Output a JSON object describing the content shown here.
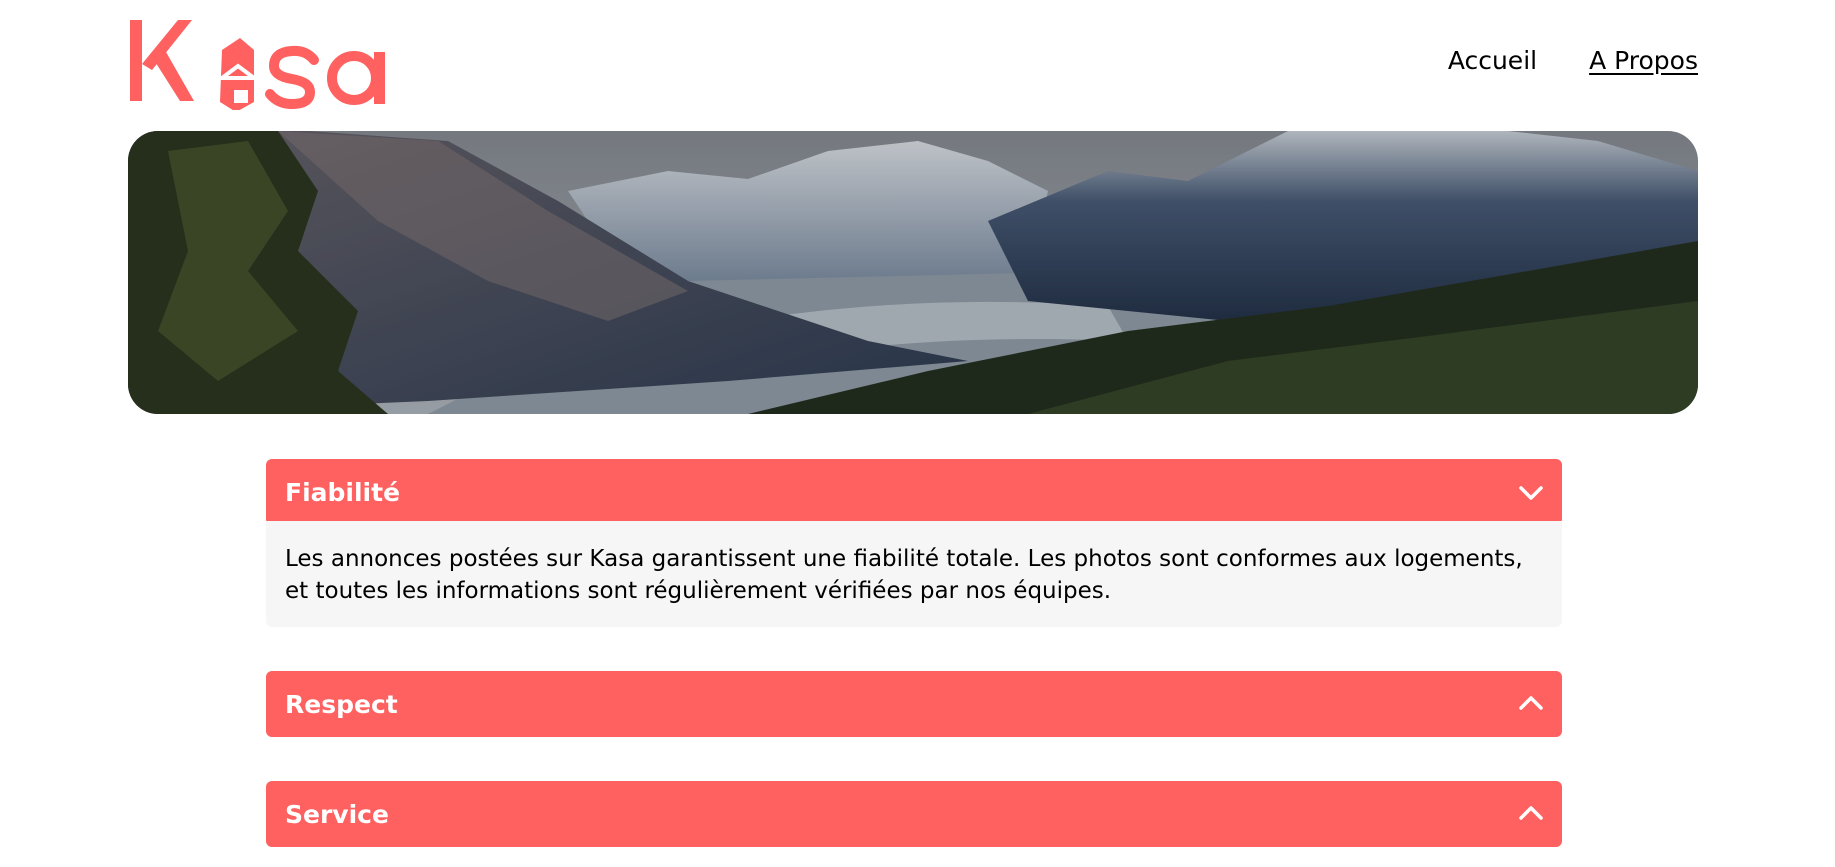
{
  "brand": {
    "logo_text": "Kasa",
    "accent_color": "#FF6060"
  },
  "nav": {
    "home": "Accueil",
    "about": "A Propos",
    "active": "about"
  },
  "banner": {
    "image": "mountain-valley-landscape"
  },
  "sections": [
    {
      "title": "Fiabilité",
      "expanded": true,
      "chevron": "chevron-down-icon",
      "body": "Les annonces postées sur Kasa garantissent une fiabilité totale. Les photos sont conformes aux logements, et toutes les informations sont régulièrement vérifiées par nos équipes."
    },
    {
      "title": "Respect",
      "expanded": false,
      "chevron": "chevron-up-icon"
    },
    {
      "title": "Service",
      "expanded": false,
      "chevron": "chevron-up-icon"
    }
  ]
}
